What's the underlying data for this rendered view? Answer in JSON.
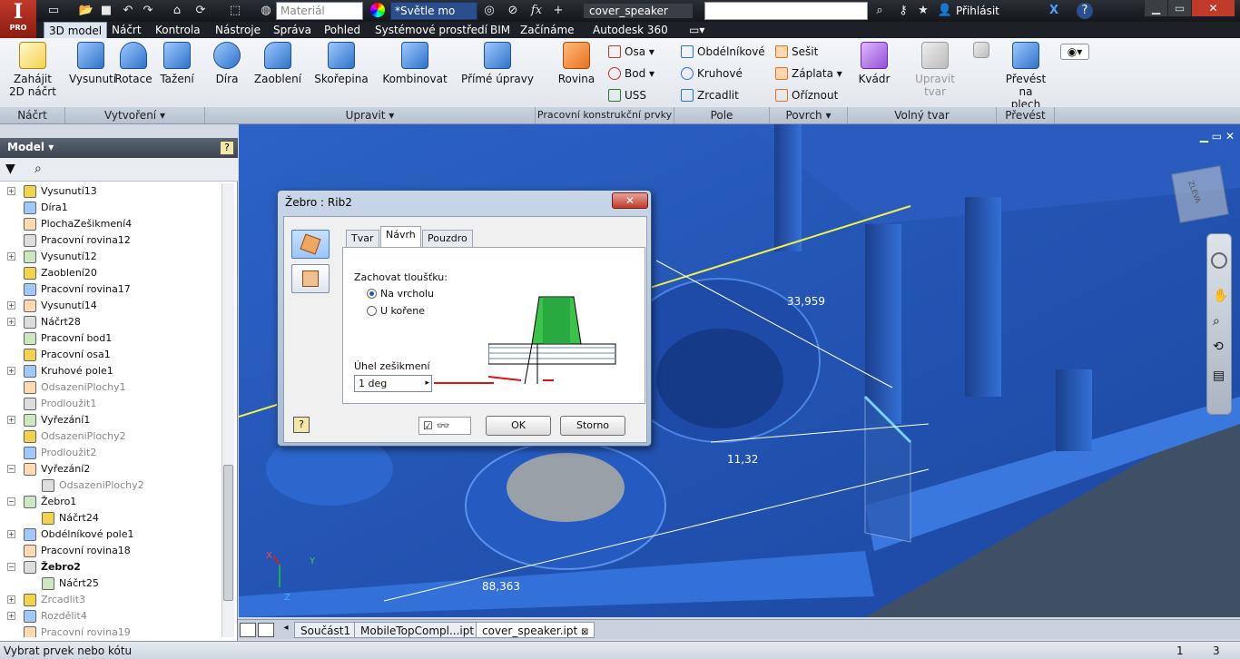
{
  "app": {
    "logo_text": "I",
    "logo_sub": "PRO",
    "material_placeholder": "Materiál",
    "appearance_value": "*Světle mo",
    "doc_title": "cover_speaker",
    "signin": "Přihlásit"
  },
  "ribbon_tabs": [
    "3D model",
    "Náčrt",
    "Kontrola",
    "Nástroje",
    "Správa",
    "Pohled",
    "Systémové prostředí",
    "BIM",
    "Začínáme",
    "Autodesk 360"
  ],
  "ribbon": {
    "groups": {
      "sketch": "Náčrt",
      "create": "Vytvoření",
      "modify": "Upravit",
      "work": "Pracovní konstrukční prvky",
      "pattern": "Pole",
      "surface": "Povrch",
      "freeform": "Volný tvar",
      "convert": "Převést"
    },
    "buttons": {
      "start_sketch_1": "Zahájit",
      "start_sketch_2": "2D náčrt",
      "extrude": "Vysunutí",
      "revolve": "Rotace",
      "sweep": "Tažení",
      "hole": "Díra",
      "fillet": "Zaoblení",
      "shell": "Skořepina",
      "combine": "Kombinovat",
      "direct_edit": "Přímé úpravy",
      "plane": "Rovina",
      "axis": "Osa",
      "point": "Bod",
      "ucs": "USS",
      "rect_pattern": "Obdélníkové",
      "circ_pattern": "Kruhové",
      "mirror": "Zrcadlit",
      "stitch": "Sešit",
      "patch": "Záplata",
      "trim": "Oříznout",
      "box": "Kvádr",
      "edit_form_1": "Upravit",
      "edit_form_2": "tvar",
      "convert_1": "Převést na",
      "convert_2": "plech"
    }
  },
  "browser": {
    "title": "Model",
    "items": [
      {
        "label": "Vysunutí13",
        "exp": "+",
        "indent": 0,
        "state": ""
      },
      {
        "label": "Díra1",
        "exp": "",
        "indent": 0,
        "state": ""
      },
      {
        "label": "PlochaZešikmení4",
        "exp": "",
        "indent": 0,
        "state": ""
      },
      {
        "label": "Pracovní rovina12",
        "exp": "",
        "indent": 0,
        "state": ""
      },
      {
        "label": "Vysunutí12",
        "exp": "+",
        "indent": 0,
        "state": ""
      },
      {
        "label": "Zaoblení20",
        "exp": "",
        "indent": 0,
        "state": ""
      },
      {
        "label": "Pracovní rovina17",
        "exp": "",
        "indent": 0,
        "state": ""
      },
      {
        "label": "Vysunutí14",
        "exp": "+",
        "indent": 0,
        "state": ""
      },
      {
        "label": "Náčrt28",
        "exp": "+",
        "indent": 0,
        "state": ""
      },
      {
        "label": "Pracovní bod1",
        "exp": "",
        "indent": 0,
        "state": ""
      },
      {
        "label": "Pracovní osa1",
        "exp": "",
        "indent": 0,
        "state": ""
      },
      {
        "label": "Kruhové pole1",
        "exp": "+",
        "indent": 0,
        "state": ""
      },
      {
        "label": "OdsazeniPlochy1",
        "exp": "",
        "indent": 0,
        "state": "dim"
      },
      {
        "label": "Prodloužit1",
        "exp": "",
        "indent": 0,
        "state": "dim"
      },
      {
        "label": "Vyřezání1",
        "exp": "+",
        "indent": 0,
        "state": ""
      },
      {
        "label": "OdsazeniPlochy2",
        "exp": "",
        "indent": 0,
        "state": "dim"
      },
      {
        "label": "Prodloužit2",
        "exp": "",
        "indent": 0,
        "state": "dim"
      },
      {
        "label": "Vyřezání2",
        "exp": "−",
        "indent": 0,
        "state": ""
      },
      {
        "label": "OdsazeniPlochy2",
        "exp": "",
        "indent": 1,
        "state": "dim"
      },
      {
        "label": "Žebro1",
        "exp": "−",
        "indent": 0,
        "state": ""
      },
      {
        "label": "Náčrt24",
        "exp": "",
        "indent": 1,
        "state": ""
      },
      {
        "label": "Obdélníkové pole1",
        "exp": "+",
        "indent": 0,
        "state": ""
      },
      {
        "label": "Pracovní rovina18",
        "exp": "",
        "indent": 0,
        "state": ""
      },
      {
        "label": "Žebro2",
        "exp": "−",
        "indent": 0,
        "state": "bold"
      },
      {
        "label": "Náčrt25",
        "exp": "",
        "indent": 1,
        "state": ""
      },
      {
        "label": "Zrcadlit3",
        "exp": "+",
        "indent": 0,
        "state": "dim"
      },
      {
        "label": "Rozdělit4",
        "exp": "+",
        "indent": 0,
        "state": "dim"
      },
      {
        "label": "Pracovní rovina19",
        "exp": "",
        "indent": 0,
        "state": "dim"
      }
    ]
  },
  "viewport": {
    "dim1": "33,959",
    "dim2": "11,32",
    "dim3": "88,363",
    "viewcube_face": "ZLEVA",
    "axis_x": "X",
    "axis_y": "Y",
    "axis_z": "Z"
  },
  "dialog": {
    "title": "Žebro : Rib2",
    "tabs": [
      "Tvar",
      "Návrh",
      "Pouzdro"
    ],
    "keep_thickness": "Zachovat tloušťku:",
    "opt_top": "Na vrcholu",
    "opt_root": "U kořene",
    "draft_angle_label": "Úhel zešikmení",
    "draft_angle_value": "1 deg",
    "ok": "OK",
    "cancel": "Storno",
    "help": "?"
  },
  "doc_tabs": [
    "Součást1",
    "MobileTopCompl...ipt",
    "cover_speaker.ipt"
  ],
  "status": {
    "text": "Vybrat prvek nebo kótu",
    "n1": "1",
    "n2": "3"
  },
  "colors": {
    "model_blue": "#1f52b0",
    "accent_red": "#c0392b"
  }
}
